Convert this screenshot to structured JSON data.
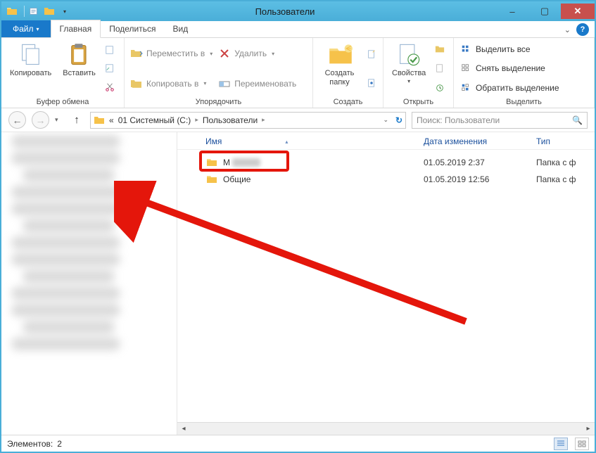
{
  "title": "Пользователи",
  "window_controls": {
    "minimize": "–",
    "maximize": "▢",
    "close": "✕"
  },
  "ribbon": {
    "file": "Файл",
    "tabs": [
      "Главная",
      "Поделиться",
      "Вид"
    ],
    "active_tab": 0,
    "groups": {
      "clipboard": {
        "label": "Буфер обмена",
        "copy": "Копировать",
        "paste": "Вставить",
        "paste_menu_items": [
          "path",
          "shortcut",
          "cut"
        ]
      },
      "organize": {
        "label": "Упорядочить",
        "move_to": "Переместить в",
        "copy_to": "Копировать в",
        "delete": "Удалить",
        "rename": "Переименовать"
      },
      "new": {
        "label": "Создать",
        "new_folder": "Создать папку"
      },
      "open": {
        "label": "Открыть",
        "properties": "Свойства"
      },
      "select": {
        "label": "Выделить",
        "select_all": "Выделить все",
        "select_none": "Снять выделение",
        "invert": "Обратить выделение"
      }
    }
  },
  "breadcrumb": {
    "prefix": "«",
    "items": [
      "01 Системный (C:)",
      "Пользователи"
    ]
  },
  "search": {
    "placeholder": "Поиск: Пользователи"
  },
  "columns": {
    "name": "Имя",
    "date": "Дата изменения",
    "type": "Тип"
  },
  "items": [
    {
      "name": "М",
      "date": "01.05.2019 2:37",
      "type": "Папка с ф",
      "blurred": true
    },
    {
      "name": "Общие",
      "date": "01.05.2019 12:56",
      "type": "Папка с ф",
      "blurred": false
    }
  ],
  "status": {
    "label": "Элементов:",
    "count": "2"
  },
  "annotation": {
    "highlight_row": 0
  }
}
